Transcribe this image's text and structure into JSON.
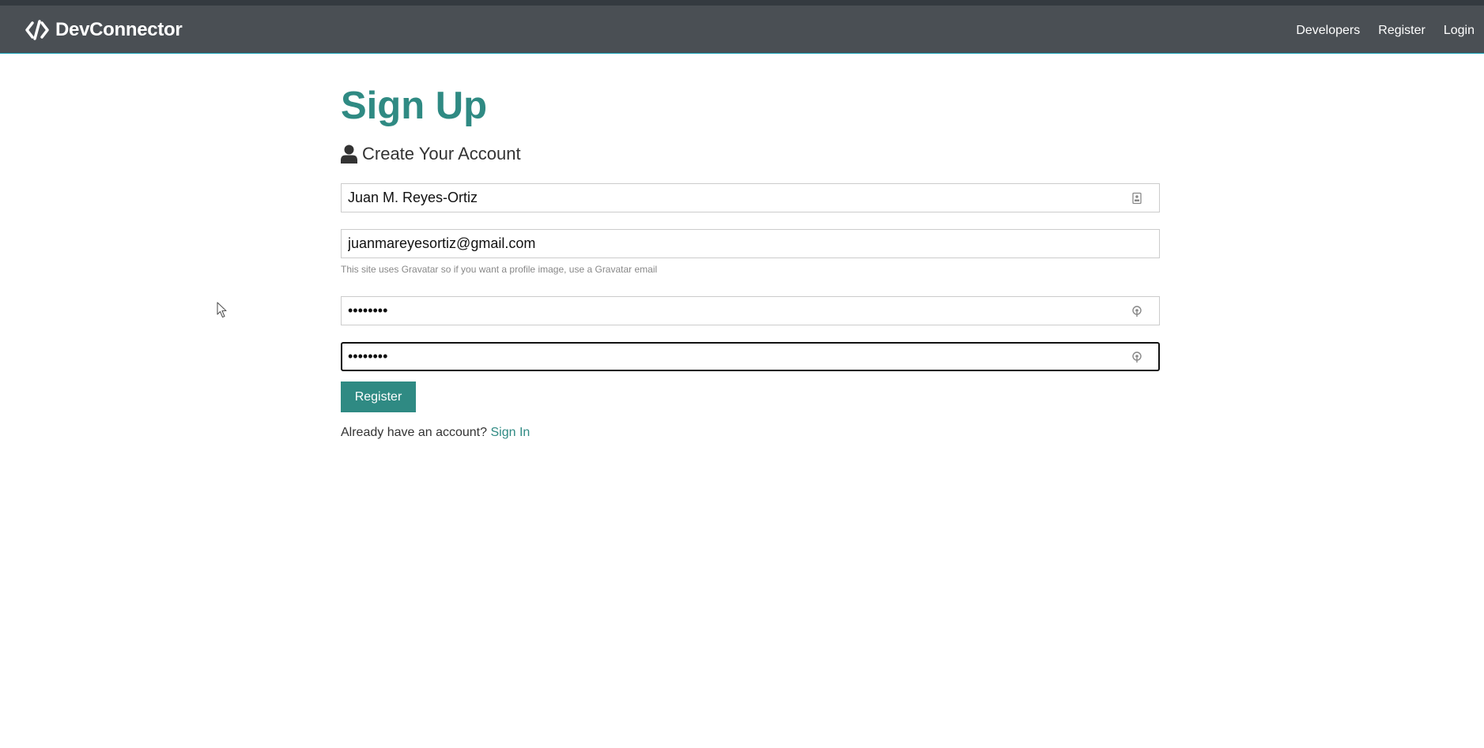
{
  "navbar": {
    "brand": "DevConnector",
    "links": [
      "Developers",
      "Register",
      "Login"
    ]
  },
  "page": {
    "title": "Sign Up",
    "lead": "Create Your Account"
  },
  "form": {
    "name_value": "Juan M. Reyes-Ortiz",
    "email_value": "juanmareyesortiz@gmail.com",
    "email_help": "This site uses Gravatar so if you want a profile image, use a Gravatar email",
    "password_value": "••••••••",
    "password2_value": "••••••••",
    "submit_label": "Register"
  },
  "footer_prompt": {
    "text": "Already have an account?",
    "link": "Sign In"
  },
  "icons": {
    "brand": "code-icon",
    "lead": "user-icon",
    "name_field": "contact-card-icon",
    "password_fields": "key-icon"
  },
  "colors": {
    "primary": "#2f8a83",
    "navbar": "#4a4f54"
  }
}
